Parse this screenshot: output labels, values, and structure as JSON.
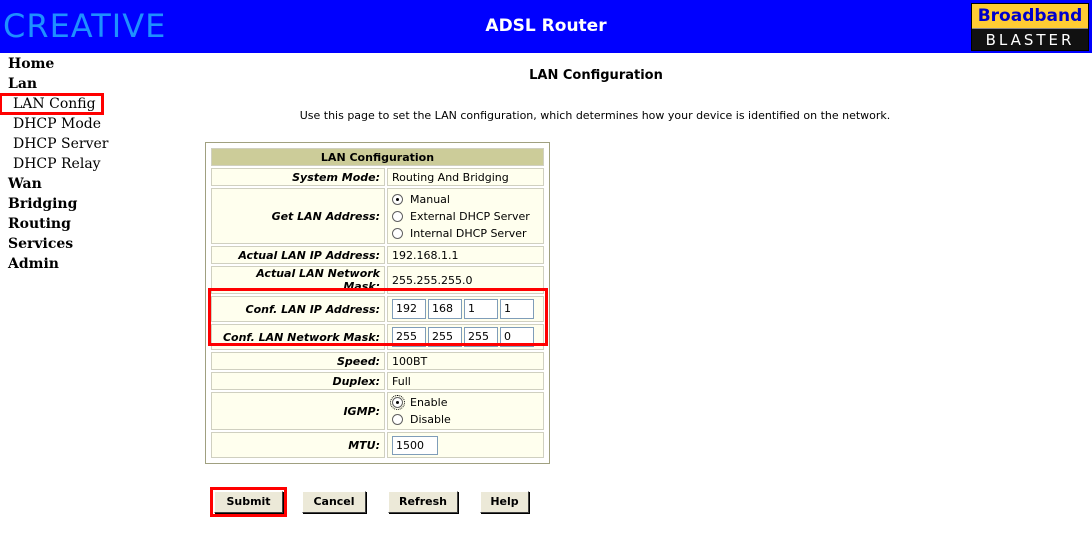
{
  "header": {
    "brand_left": "CREATIVE",
    "title": "ADSL Router",
    "brand_right_top": "Broadband",
    "brand_right_bottom": "BLASTER"
  },
  "sidebar": {
    "items": [
      {
        "label": "Home",
        "level": "main"
      },
      {
        "label": "Lan",
        "level": "main"
      },
      {
        "label": "LAN Config",
        "level": "sub",
        "active": true
      },
      {
        "label": "DHCP Mode",
        "level": "sub"
      },
      {
        "label": "DHCP Server",
        "level": "sub"
      },
      {
        "label": "DHCP Relay",
        "level": "sub"
      },
      {
        "label": "Wan",
        "level": "main"
      },
      {
        "label": "Bridging",
        "level": "main"
      },
      {
        "label": "Routing",
        "level": "main"
      },
      {
        "label": "Services",
        "level": "main"
      },
      {
        "label": "Admin",
        "level": "main"
      }
    ]
  },
  "main": {
    "heading": "LAN Configuration",
    "description": "Use this page to set the LAN configuration, which determines how your device is identified on the network.",
    "table": {
      "title": "LAN Configuration",
      "system_mode_label": "System Mode:",
      "system_mode_value": "Routing And Bridging",
      "get_lan_label": "Get LAN Address:",
      "get_lan_options": [
        "Manual",
        "External DHCP Server",
        "Internal DHCP Server"
      ],
      "get_lan_selected": "Manual",
      "actual_ip_label": "Actual LAN IP Address:",
      "actual_ip_value": "192.168.1.1",
      "actual_mask_label": "Actual LAN Network Mask:",
      "actual_mask_value": "255.255.255.0",
      "conf_ip_label": "Conf. LAN IP Address:",
      "conf_ip_octets": [
        "192",
        "168",
        "1",
        "1"
      ],
      "conf_mask_label": "Conf. LAN Network Mask:",
      "conf_mask_octets": [
        "255",
        "255",
        "255",
        "0"
      ],
      "speed_label": "Speed:",
      "speed_value": "100BT",
      "duplex_label": "Duplex:",
      "duplex_value": "Full",
      "igmp_label": "IGMP:",
      "igmp_options": [
        "Enable",
        "Disable"
      ],
      "igmp_selected": "Enable",
      "mtu_label": "MTU:",
      "mtu_value": "1500"
    },
    "buttons": {
      "submit": "Submit",
      "cancel": "Cancel",
      "refresh": "Refresh",
      "help": "Help"
    }
  },
  "colors": {
    "header_bg": "#0000ff",
    "table_header_bg": "#cccc99",
    "table_cell_bg": "#ffffee",
    "highlight": "#ff0000"
  }
}
